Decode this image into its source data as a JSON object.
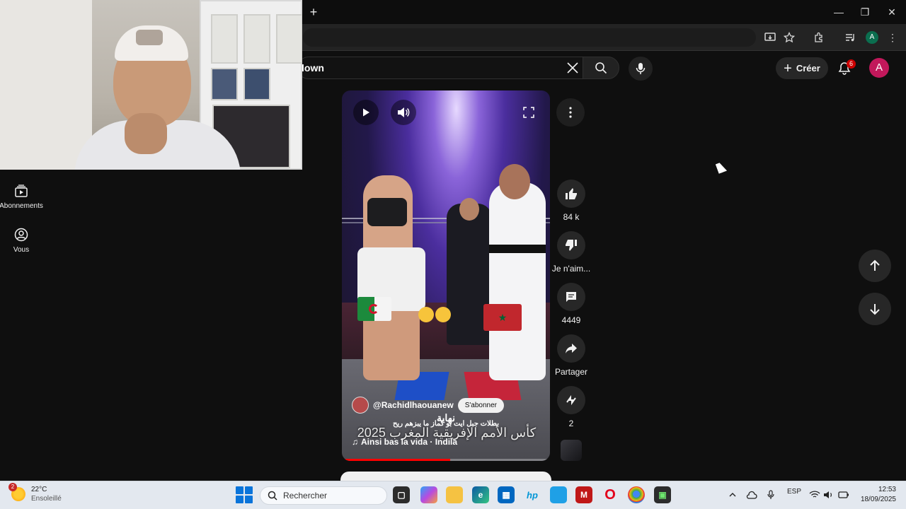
{
  "colors": {
    "accent": "#ff0000",
    "background": "#0f0f0f",
    "avatar": "#c2185b",
    "badge": "#cc0000"
  },
  "browser": {
    "new_tab_icon": "plus-icon",
    "window_controls": {
      "minimize": "—",
      "restore": "❐",
      "close": "✕"
    }
  },
  "header": {
    "search_query": "lown",
    "create_label": "Créer",
    "notifications_count": "6",
    "avatar_letter": "A",
    "profile_letter": "A"
  },
  "sidebar": {
    "items": [
      {
        "label": "Abonnements",
        "icon": "subscriptions-icon"
      },
      {
        "label": "Vous",
        "icon": "account-icon"
      }
    ]
  },
  "short": {
    "channel": "@Rachidlhaouanew",
    "subscribe_label": "S'abonner",
    "title": "بطلات جبل ايت بو كماز ما يبزهم ريح",
    "caption": "نهاية",
    "overlay_text": "كأس الأمم الإفريقية المغرب 2025",
    "music": "Ainsi bas la vida · Indila",
    "progress": 0.52
  },
  "actions": {
    "like_count": "84 k",
    "dislike_label": "Je n'aim...",
    "comments_count": "4449",
    "share_label": "Partager",
    "remix_count": "2"
  },
  "taskbar": {
    "weather_temp": "22°C",
    "weather_desc": "Ensoleillé",
    "weather_badge": "2",
    "search_placeholder": "Rechercher",
    "language": "ESP",
    "time": "12:53",
    "date": "18/09/2025"
  }
}
